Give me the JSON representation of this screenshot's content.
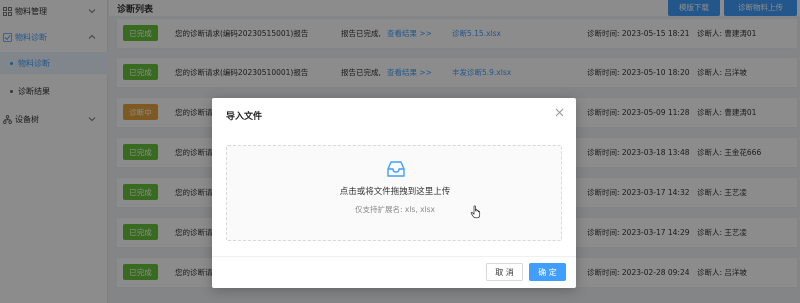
{
  "sidebar": {
    "items": [
      {
        "label": "物料管理",
        "icon": "grid-icon"
      },
      {
        "label": "物料诊断",
        "icon": "diagnosis-icon"
      },
      {
        "label": "物料诊断"
      },
      {
        "label": "诊断结果"
      },
      {
        "label": "设备树",
        "icon": "tree-icon"
      }
    ]
  },
  "header": {
    "title": "诊断列表",
    "template_download": "模版下载",
    "upload": "诊断物料上传"
  },
  "rows": [
    {
      "status": "已完成",
      "status_type": "done",
      "request": "您的诊断请求(编码20230515001)报告",
      "completed": "报告已完成,",
      "view": "查看结果 >>",
      "file": "诊断5.15.xlsx",
      "time": "诊断时间: 2023-05-15 18:21",
      "person": "诊断人: 曹建涛01"
    },
    {
      "status": "已完成",
      "status_type": "done",
      "request": "您的诊断请求(编码20230510001)报告",
      "completed": "报告已完成,",
      "view": "查看结果 >>",
      "file": "丰发诊断5.9.xlsx",
      "time": "诊断时间: 2023-05-10 18:20",
      "person": "诊断人: 吕洋坡"
    },
    {
      "status": "诊断中",
      "status_type": "progress",
      "request": "您的诊断请求",
      "completed": "",
      "view": "",
      "file": "",
      "time": "诊断时间: 2023-05-09 11:28",
      "person": "诊断人: 曹建涛01"
    },
    {
      "status": "已完成",
      "status_type": "done",
      "request": "您的诊断请",
      "completed": "",
      "view": "",
      "file": "",
      "time": "诊断时间: 2023-03-18 13:48",
      "person": "诊断人: 王金花666"
    },
    {
      "status": "已完成",
      "status_type": "done",
      "request": "您的诊断请",
      "completed": "",
      "view": "",
      "file": "",
      "time": "诊断时间: 2023-03-17 14:32",
      "person": "诊断人: 王艺凌"
    },
    {
      "status": "已完成",
      "status_type": "done",
      "request": "您的诊断请",
      "completed": "",
      "view": "",
      "file": "",
      "time": "诊断时间: 2023-03-17 14:29",
      "person": "诊断人: 王艺凌"
    },
    {
      "status": "已完成",
      "status_type": "done",
      "request": "您的诊断请",
      "completed": "",
      "view": "",
      "file": "",
      "time": "诊断时间: 2023-02-28 09:24",
      "person": "诊断人: 吕洋坡"
    }
  ],
  "modal": {
    "title": "导入文件",
    "upload_text": "点击或将文件拖拽到这里上传",
    "hint": "仅支持扩展名: xls, xlsx",
    "cancel": "取 消",
    "ok": "确 定"
  },
  "colors": {
    "primary": "#409eff",
    "success": "#67c23a",
    "warning": "#e6a23c"
  }
}
